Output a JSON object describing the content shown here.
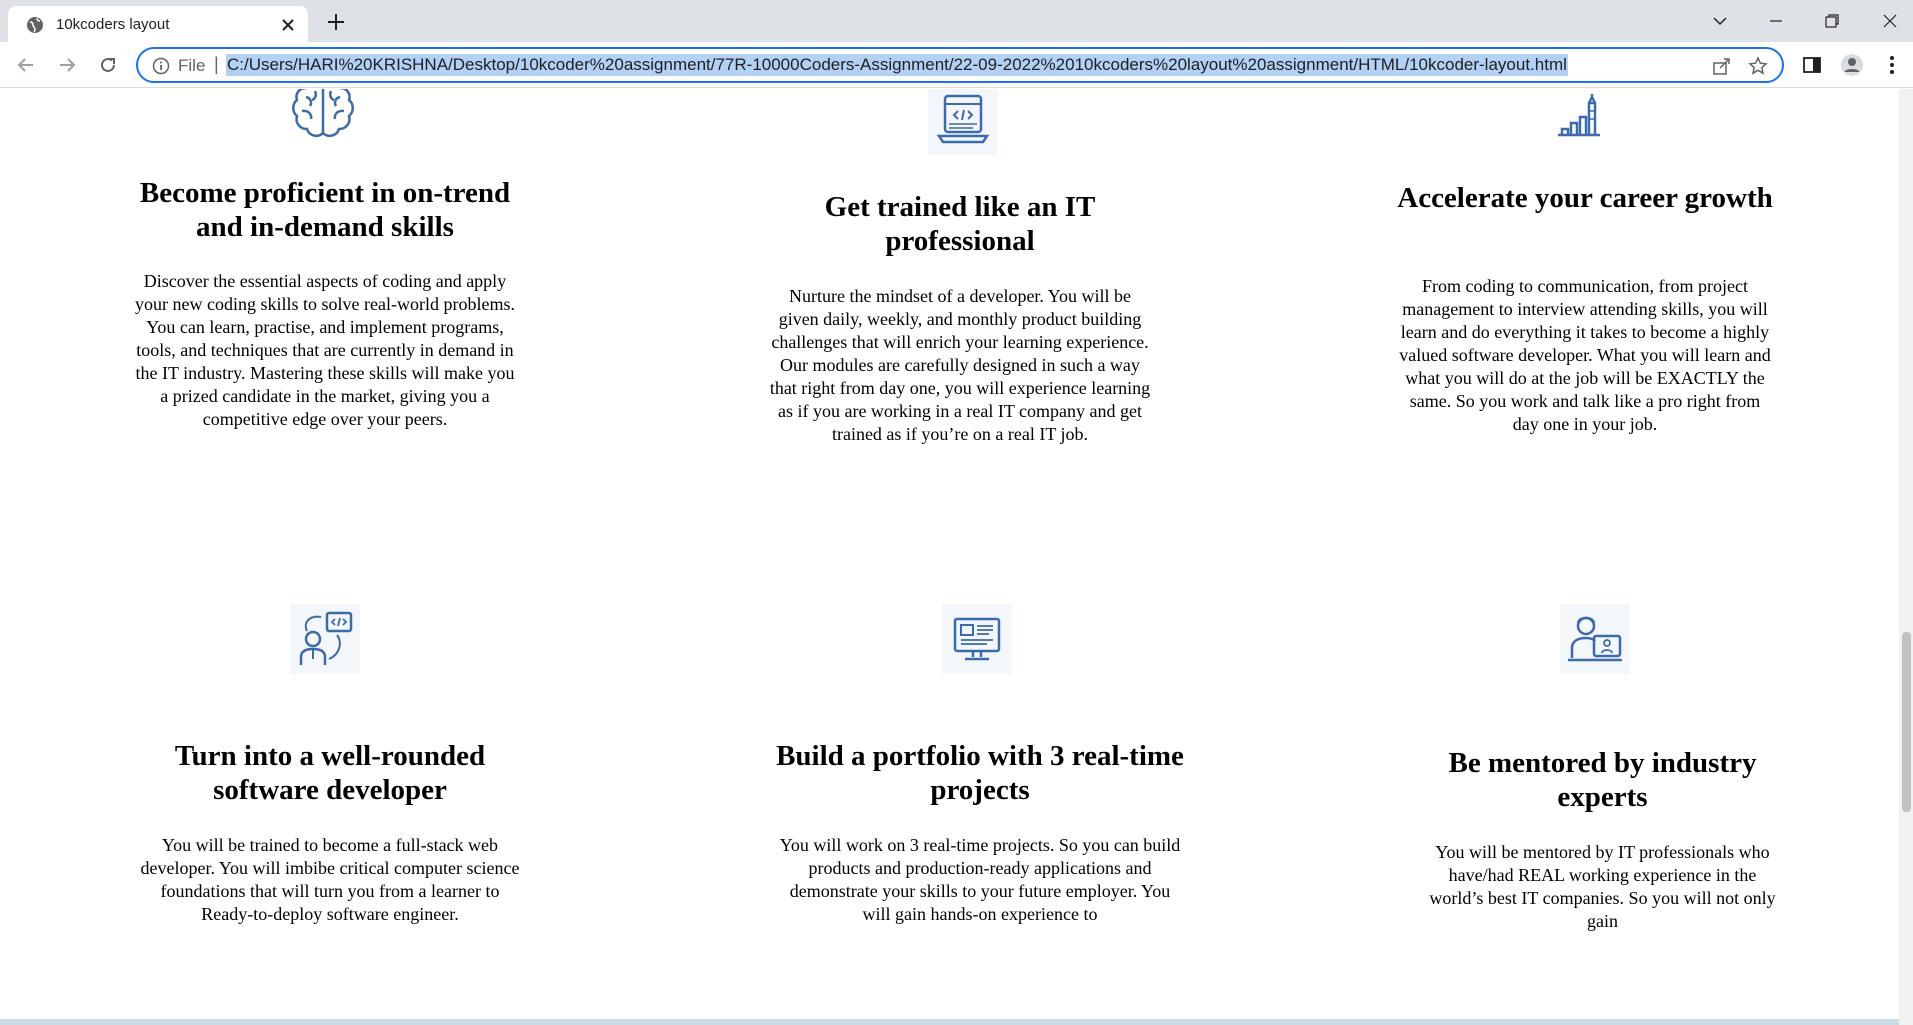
{
  "browser": {
    "tab_title": "10kcoders layout",
    "address_label": "File",
    "url": "C:/Users/HARI%20KRISHNA/Desktop/10kcoder%20assignment/77R-10000Coders-Assignment/22-09-2022%2010kcoders%20layout%20assignment/HTML/10kcoder-layout.html",
    "accent_color": "#1a73e8",
    "icons": [
      "globe-icon",
      "close-icon",
      "plus-icon",
      "chevron-down-icon",
      "minimize-icon",
      "restore-icon",
      "close-window-icon",
      "back-arrow-icon",
      "forward-arrow-icon",
      "reload-icon",
      "info-icon",
      "share-icon",
      "star-icon",
      "side-panel-icon",
      "profile-icon",
      "menu-dots-icon"
    ]
  },
  "features": [
    {
      "icon": "brain-icon",
      "title": "Become proficient in on-trend and in-demand skills",
      "text": "Discover the essential aspects of coding and apply your new coding skills to solve real-world problems. You can learn, practise, and implement programs, tools, and techniques that are currently in demand in the IT industry. Mastering these skills will make you a prized candidate in the market, giving you a competitive edge over your peers."
    },
    {
      "icon": "laptop-code-icon",
      "title": "Get trained like an IT professional",
      "text": "Nurture the mindset of a developer. You will be given daily, weekly, and monthly product building challenges that will enrich your learning experience. Our modules are carefully designed in such a way that right from day one, you will experience learning as if you are working in a real IT company and get trained as if you’re on a real IT job."
    },
    {
      "icon": "growth-chart-icon",
      "title": "Accelerate your career growth",
      "text": "From coding to communication, from project management to interview attending skills, you will learn and do everything it takes to become a highly valued software developer. What you will learn and what you will do at the job will be EXACTLY the same. So you work and talk like a pro right from day one in your job."
    },
    {
      "icon": "developer-icon",
      "title": "Turn into a well-rounded software developer",
      "text": "You will be trained to become a full-stack web developer. You will imbibe critical computer science foundations that will turn you from a learner to Ready-to-deploy software engineer."
    },
    {
      "icon": "monitor-icon",
      "title": "Build a portfolio with 3 real-time projects",
      "text": "You will work on 3 real-time projects. So you can build products and production-ready applications and demonstrate your skills to your future employer. You will gain hands-on experience to"
    },
    {
      "icon": "mentor-icon",
      "title": "Be mentored by industry experts",
      "text": "You will be mentored by IT professionals who have/had REAL working experience in the world’s best IT companies. So you will not only gain"
    }
  ]
}
